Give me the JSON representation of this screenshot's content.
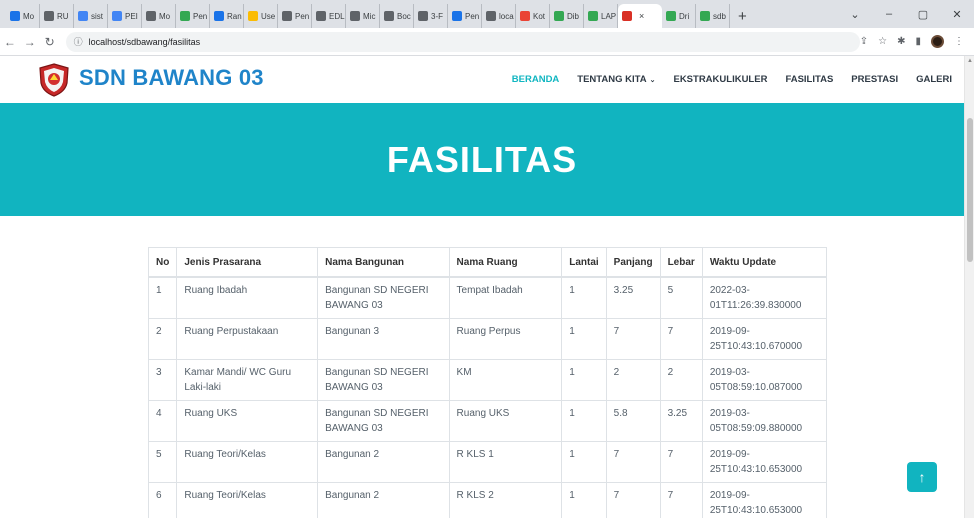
{
  "browser": {
    "tabs": [
      {
        "label": "Mo",
        "color": "#1a73e8"
      },
      {
        "label": "RU",
        "color": "#5f6368"
      },
      {
        "label": "sist",
        "color": "#4285f4"
      },
      {
        "label": "PEI",
        "color": "#4285f4"
      },
      {
        "label": "Mo",
        "color": "#5f6368"
      },
      {
        "label": "Pen",
        "color": "#34a853"
      },
      {
        "label": "Ran",
        "color": "#1a73e8"
      },
      {
        "label": "Use",
        "color": "#fbbc04"
      },
      {
        "label": "Pen",
        "color": "#5f6368"
      },
      {
        "label": "EDL",
        "color": "#5f6368"
      },
      {
        "label": "Mic",
        "color": "#5f6368"
      },
      {
        "label": "Boc",
        "color": "#5f6368"
      },
      {
        "label": "3-F",
        "color": "#5f6368"
      },
      {
        "label": "Pen",
        "color": "#1a73e8"
      },
      {
        "label": "loca",
        "color": "#5f6368"
      },
      {
        "label": "Kot",
        "color": "#ea4335"
      },
      {
        "label": "Dib",
        "color": "#34a853"
      },
      {
        "label": "LAP",
        "color": "#34a853"
      }
    ],
    "active_tab": {
      "label": "×",
      "color": "#d93025"
    },
    "tabs_after": [
      {
        "label": "Dri",
        "color": "#34a853"
      },
      {
        "label": "sdb",
        "color": "#34a853"
      }
    ],
    "new_tab": "+",
    "url": "localhost/sdbawang/fasilitas",
    "window_controls": {
      "dropdown": "⌄",
      "minimize": "–",
      "restore": "▢",
      "close": "✕"
    }
  },
  "site": {
    "name": "SDN BAWANG 03",
    "nav": [
      {
        "label": "BERANDA",
        "active": true,
        "has_dropdown": false
      },
      {
        "label": "TENTANG KITA",
        "active": false,
        "has_dropdown": true
      },
      {
        "label": "EKSTRAKULIKULER",
        "active": false,
        "has_dropdown": false
      },
      {
        "label": "FASILITAS",
        "active": false,
        "has_dropdown": false
      },
      {
        "label": "PRESTASI",
        "active": false,
        "has_dropdown": false
      },
      {
        "label": "GALERI",
        "active": false,
        "has_dropdown": false
      }
    ],
    "accent_color": "#11b4c0",
    "brand_color": "#1f84c9"
  },
  "hero": {
    "title": "FASILITAS"
  },
  "table": {
    "headers": [
      "No",
      "Jenis Prasarana",
      "Nama Bangunan",
      "Nama Ruang",
      "Lantai",
      "Panjang",
      "Lebar",
      "Waktu Update"
    ],
    "rows": [
      [
        "1",
        "Ruang Ibadah",
        "Bangunan SD NEGERI BAWANG 03",
        "Tempat Ibadah",
        "1",
        "3.25",
        "5",
        "2022-03-01T11:26:39.830000"
      ],
      [
        "2",
        "Ruang Perpustakaan",
        "Bangunan 3",
        "Ruang Perpus",
        "1",
        "7",
        "7",
        "2019-09-25T10:43:10.670000"
      ],
      [
        "3",
        "Kamar Mandi/ WC Guru Laki-laki",
        "Bangunan SD NEGERI BAWANG 03",
        "KM",
        "1",
        "2",
        "2",
        "2019-03-05T08:59:10.087000"
      ],
      [
        "4",
        "Ruang UKS",
        "Bangunan SD NEGERI BAWANG 03",
        "Ruang UKS",
        "1",
        "5.8",
        "3.25",
        "2019-03-05T08:59:09.880000"
      ],
      [
        "5",
        "Ruang Teori/Kelas",
        "Bangunan 2",
        "R KLS 1",
        "1",
        "7",
        "7",
        "2019-09-25T10:43:10.653000"
      ],
      [
        "6",
        "Ruang Teori/Kelas",
        "Bangunan 2",
        "R KLS 2",
        "1",
        "7",
        "7",
        "2019-09-25T10:43:10.653000"
      ]
    ]
  },
  "back_to_top": "↑"
}
